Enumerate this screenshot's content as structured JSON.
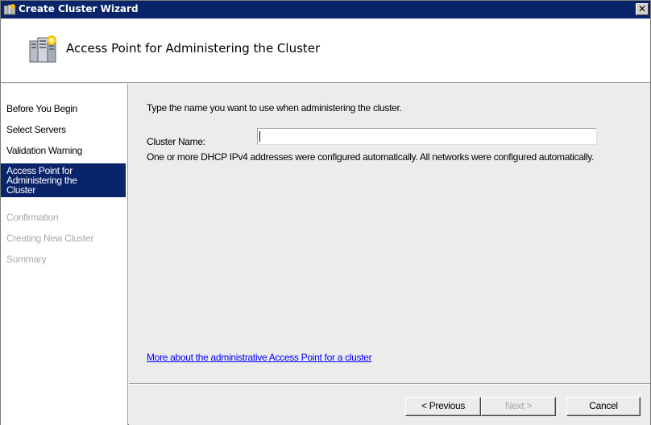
{
  "window": {
    "title": "Create Cluster Wizard",
    "close_glyph": "✕"
  },
  "header": {
    "title": "Access Point for Administering the Cluster",
    "icon": "cluster-servers-icon"
  },
  "steps": [
    {
      "label": "Before You Begin",
      "state": "done"
    },
    {
      "label": "Select Servers",
      "state": "done"
    },
    {
      "label": "Validation Warning",
      "state": "done"
    },
    {
      "label": "Access Point for Administering the Cluster",
      "line1": "Access Point for",
      "line2": "Administering the",
      "line3": "Cluster",
      "state": "active"
    },
    {
      "label": "Confirmation",
      "state": "disabled"
    },
    {
      "label": "Creating New Cluster",
      "state": "disabled"
    },
    {
      "label": "Summary",
      "state": "disabled"
    }
  ],
  "content": {
    "instruction": "Type the name you want to use when administering the cluster.",
    "cluster_name_label": "Cluster Name:",
    "cluster_name_value": "",
    "dhcp_note": "One or more DHCP IPv4 addresses were configured automatically.  All networks were configured automatically.",
    "help_link": "More about the administrative Access Point for a cluster"
  },
  "buttons": {
    "previous": "< Previous",
    "next": "Next >",
    "cancel": "Cancel"
  },
  "colors": {
    "titlebar": "#0a246a",
    "active_step": "#0a246a",
    "disabled_text": "#a8a8a8",
    "link": "#0000ff"
  }
}
